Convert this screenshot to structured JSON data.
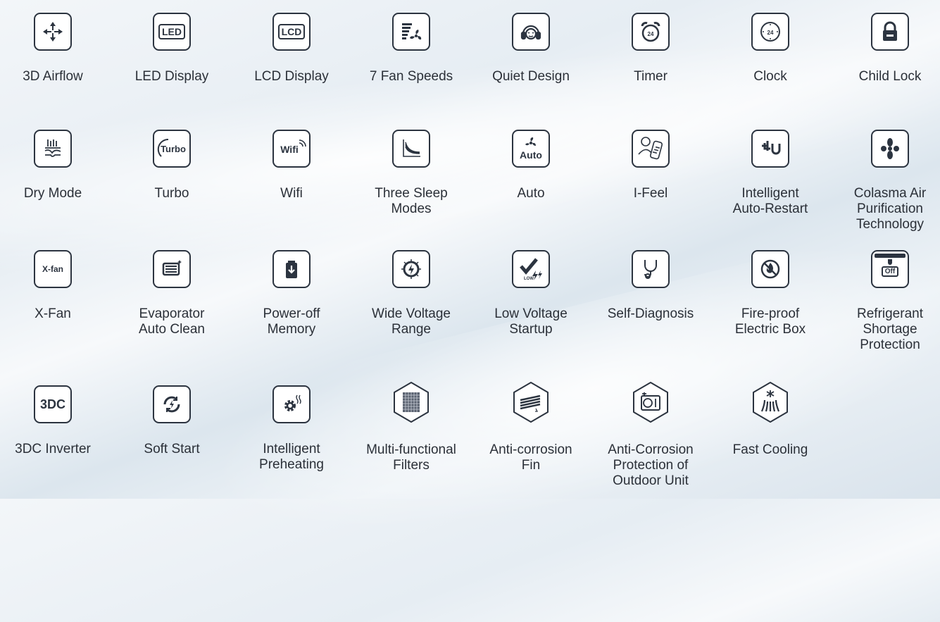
{
  "features": [
    {
      "label": "3D Airflow",
      "icon": "airflow-icon"
    },
    {
      "label": "LED Display",
      "icon": "led-icon",
      "text": "LED"
    },
    {
      "label": "LCD Display",
      "icon": "lcd-icon",
      "text": "LCD"
    },
    {
      "label": "7 Fan Speeds",
      "icon": "fan-speeds-icon"
    },
    {
      "label": "Quiet Design",
      "icon": "quiet-icon"
    },
    {
      "label": "Timer",
      "icon": "alarm-clock-icon",
      "text": "24"
    },
    {
      "label": "Clock",
      "icon": "clock-icon",
      "text": "24"
    },
    {
      "label": "Child Lock",
      "icon": "lock-icon"
    },
    {
      "label": "Dry Mode",
      "icon": "dry-mode-icon"
    },
    {
      "label": "Turbo",
      "icon": "turbo-icon",
      "text": "Turbo"
    },
    {
      "label": "Wifi",
      "icon": "wifi-icon",
      "text": "Wifi"
    },
    {
      "label": "Three Sleep\nModes",
      "icon": "sleep-curve-icon"
    },
    {
      "label": "Auto",
      "icon": "auto-fan-icon",
      "text": "Auto"
    },
    {
      "label": "I-Feel",
      "icon": "remote-person-icon"
    },
    {
      "label": "Intelligent\nAuto-Restart",
      "icon": "restart-plug-icon"
    },
    {
      "label": "Colasma Air\nPurification\nTechnology",
      "icon": "purifier-icon"
    },
    {
      "label": "X-Fan",
      "icon": "xfan-icon",
      "text": "X-fan"
    },
    {
      "label": "Evaporator\nAuto Clean",
      "icon": "evaporator-icon"
    },
    {
      "label": "Power-off\nMemory",
      "icon": "battery-icon"
    },
    {
      "label": "Wide Voltage\nRange",
      "icon": "voltage-range-icon"
    },
    {
      "label": "Low Voltage\nStartup",
      "icon": "low-voltage-icon",
      "text": "LOW"
    },
    {
      "label": "Self-Diagnosis",
      "icon": "stethoscope-icon"
    },
    {
      "label": "Fire-proof\nElectric Box",
      "icon": "fire-icon"
    },
    {
      "label": "Refrigerant\nShortage\nProtection",
      "icon": "refrigerant-off-icon",
      "text": "Off"
    },
    {
      "label": "3DC Inverter",
      "icon": "3dc-icon",
      "text": "3DC"
    },
    {
      "label": "Soft Start",
      "icon": "soft-start-icon"
    },
    {
      "label": "Intelligent\nPreheating",
      "icon": "preheat-gear-icon"
    },
    {
      "label": "Multi-functional\nFilters",
      "icon": "filter-icon"
    },
    {
      "label": "Anti-corrosion\nFin",
      "icon": "fin-icon"
    },
    {
      "label": "Anti-Corrosion\nProtection of\nOutdoor Unit",
      "icon": "outdoor-unit-icon"
    },
    {
      "label": "Fast Cooling",
      "icon": "fast-cooling-icon"
    }
  ]
}
